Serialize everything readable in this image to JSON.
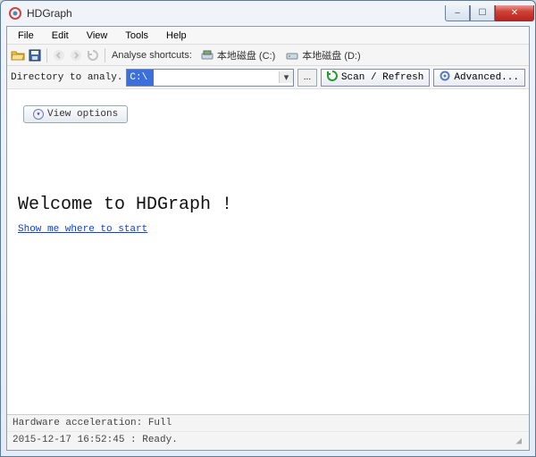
{
  "window": {
    "title": "HDGraph",
    "buttons": {
      "min": "–",
      "max": "☐",
      "close": "✕"
    }
  },
  "menubar": {
    "items": [
      "File",
      "Edit",
      "View",
      "Tools",
      "Help"
    ]
  },
  "toolbar": {
    "analyse_shortcuts_label": "Analyse shortcuts:",
    "shortcut_c": "本地磁盘 (C:)",
    "shortcut_d": "本地磁盘 (D:)"
  },
  "pathbar": {
    "label": "Directory to analy.",
    "value": "C:\\",
    "browse_label": "...",
    "scan_label": "Scan / Refresh",
    "advanced_label": "Advanced..."
  },
  "body": {
    "view_options": "View options",
    "welcome": "Welcome to HDGraph !",
    "start_link": "Show me where to start"
  },
  "status": {
    "accel": "Hardware acceleration: Full",
    "ready": "2015-12-17 16:52:45 : Ready."
  },
  "glyphs": {
    "chev_down": "▾"
  }
}
